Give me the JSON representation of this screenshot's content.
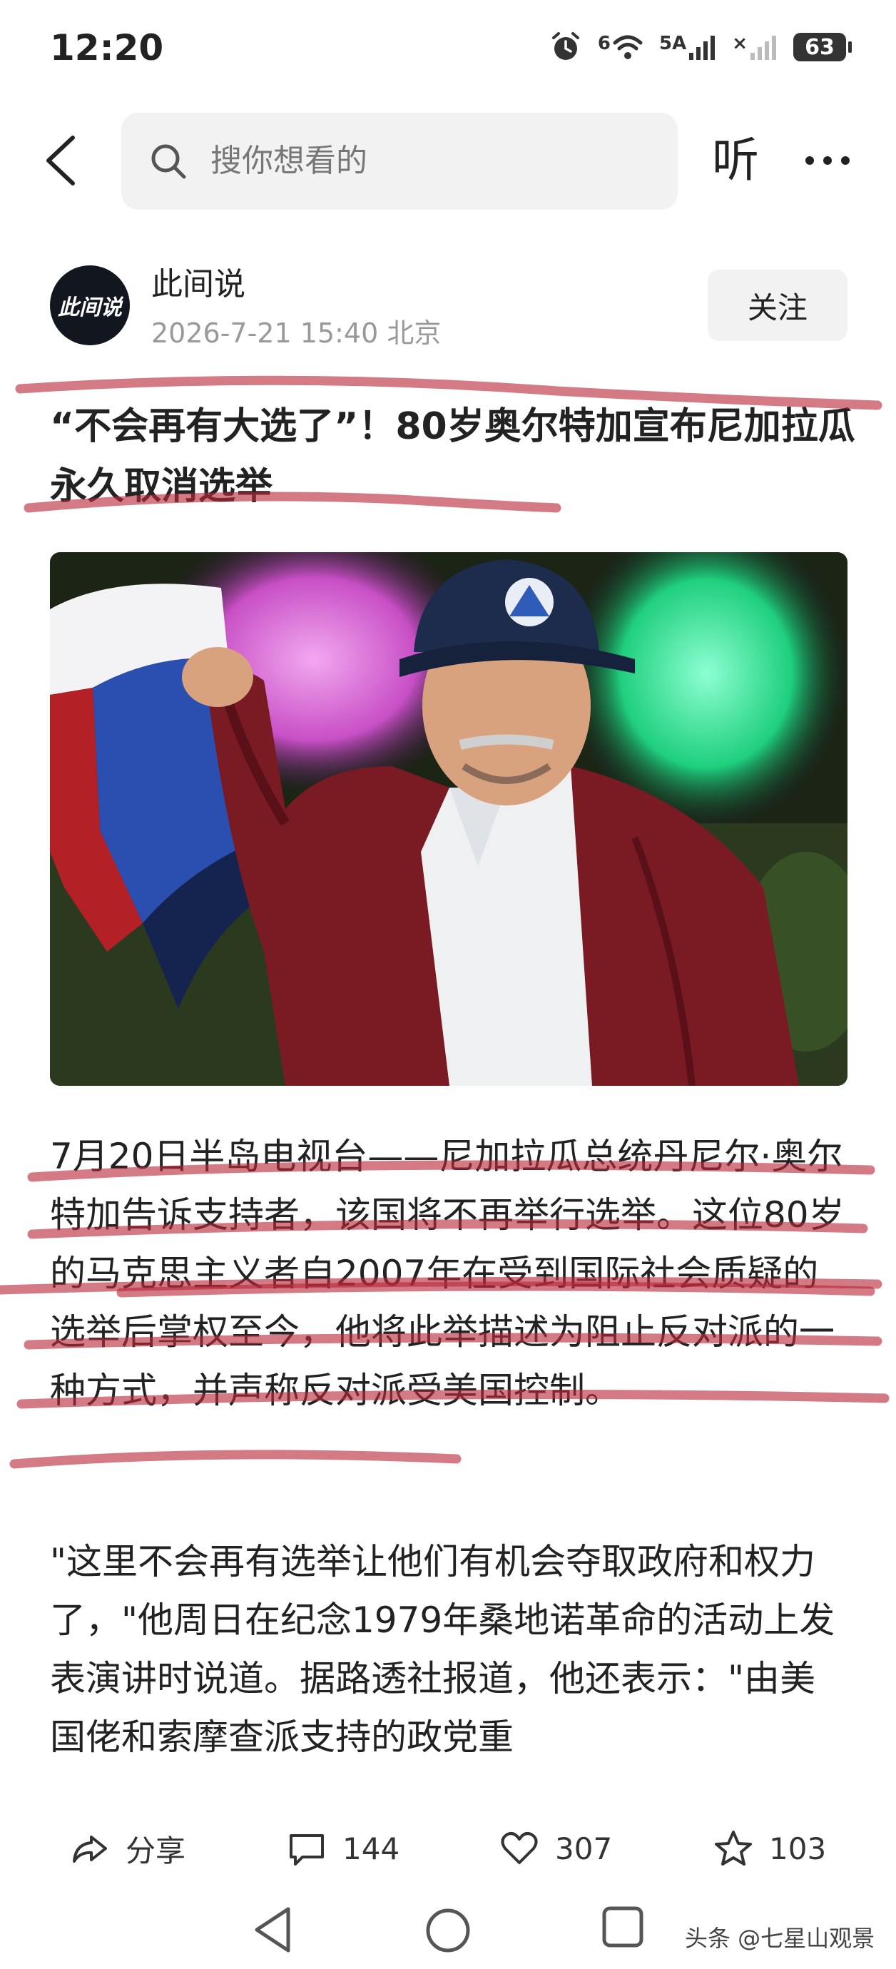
{
  "status_bar": {
    "time": "12:20",
    "signal_6": "6",
    "signal_5a": "5A",
    "signal_x": "×",
    "battery": "63"
  },
  "header": {
    "search_placeholder": "搜你想看的",
    "listen_label": "听"
  },
  "author": {
    "avatar_text": "此间说",
    "name": "此间说",
    "meta": "2026-7-21  15:40  北京",
    "follow_label": "关注"
  },
  "article": {
    "headline": "“不会再有大选了”！80岁奥尔特加宣布尼加拉瓜永久取消选举",
    "paragraph1": "7月20日半岛电视台——尼加拉瓜总统丹尼尔·奥尔特加告诉支持者，该国将不再举行选举。这位80岁的马克思主义者自2007年在受到国际社会质疑的选举后掌权至今，他将此举描述为阻止反对派的一种方式，并声称反对派受美国控制。",
    "paragraph2": "\"这里不会再有选举让他们有机会夺取政府和权力了，\"他周日在纪念1979年桑地诺革命的活动上发表演讲时说道。据路透社报道，他还表示：\"由美国佬和索摩查派支持的政党重"
  },
  "actions": {
    "share_label": "分享",
    "comments": "144",
    "likes": "307",
    "favorites": "103"
  },
  "watermark": "头条 @七星山观景",
  "colors": {
    "marker": "#b8283a",
    "jacket": "#7a1a22",
    "cap": "#1d2b4d"
  }
}
